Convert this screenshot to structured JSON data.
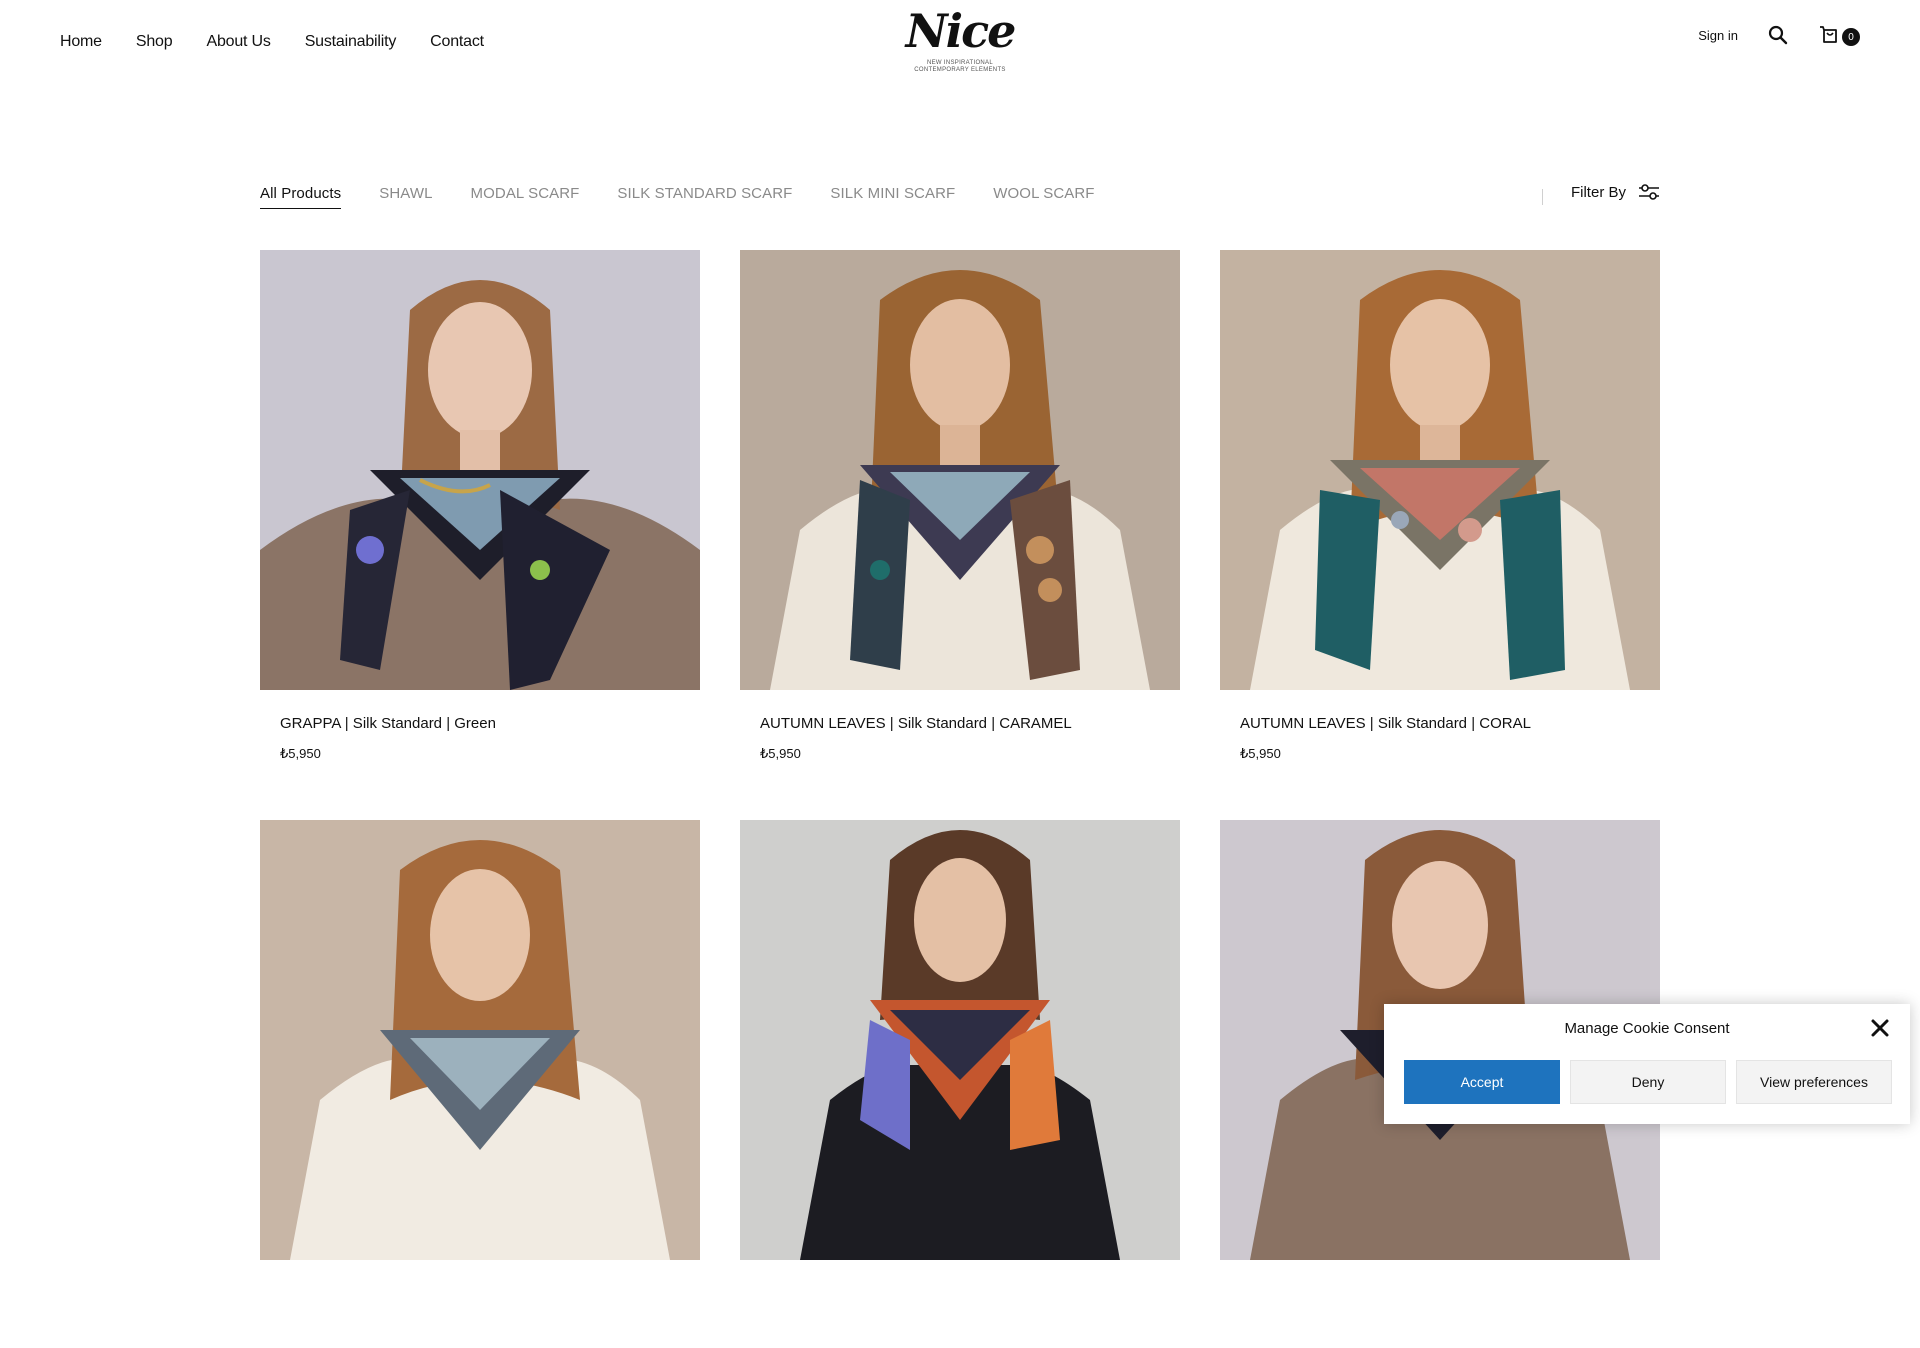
{
  "nav": {
    "items": [
      "Home",
      "Shop",
      "About Us",
      "Sustainability",
      "Contact"
    ]
  },
  "logo": {
    "script": "Nice",
    "tagline_1": "NEW INSPIRATIONAL",
    "tagline_2": "CONTEMPORARY ELEMENTS"
  },
  "header_right": {
    "signin": "Sign in",
    "search_icon": "search-icon",
    "cart_icon": "cart-icon",
    "cart_count": "0"
  },
  "categories": {
    "tabs": [
      "All Products",
      "SHAWL",
      "MODAL SCARF",
      "SILK STANDARD SCARF",
      "SILK MINI SCARF",
      "WOOL SCARF"
    ],
    "active": "All Products",
    "filter_label": "Filter By",
    "filter_icon": "sliders-icon"
  },
  "products": [
    {
      "title": "GRAPPA | Silk Standard | Green",
      "price": "₺5,950"
    },
    {
      "title": "AUTUMN LEAVES | Silk Standard | CARAMEL",
      "price": "₺5,950"
    },
    {
      "title": "AUTUMN LEAVES | Silk Standard | CORAL",
      "price": "₺5,950"
    },
    {
      "title": "",
      "price": ""
    },
    {
      "title": "",
      "price": ""
    },
    {
      "title": "",
      "price": ""
    }
  ],
  "cookie": {
    "title": "Manage Cookie Consent",
    "accept": "Accept",
    "deny": "Deny",
    "view": "View preferences",
    "close_icon": "close-icon"
  },
  "colors": {
    "accent": "#1e73be",
    "text": "#111111",
    "muted": "#8a8a8a"
  }
}
